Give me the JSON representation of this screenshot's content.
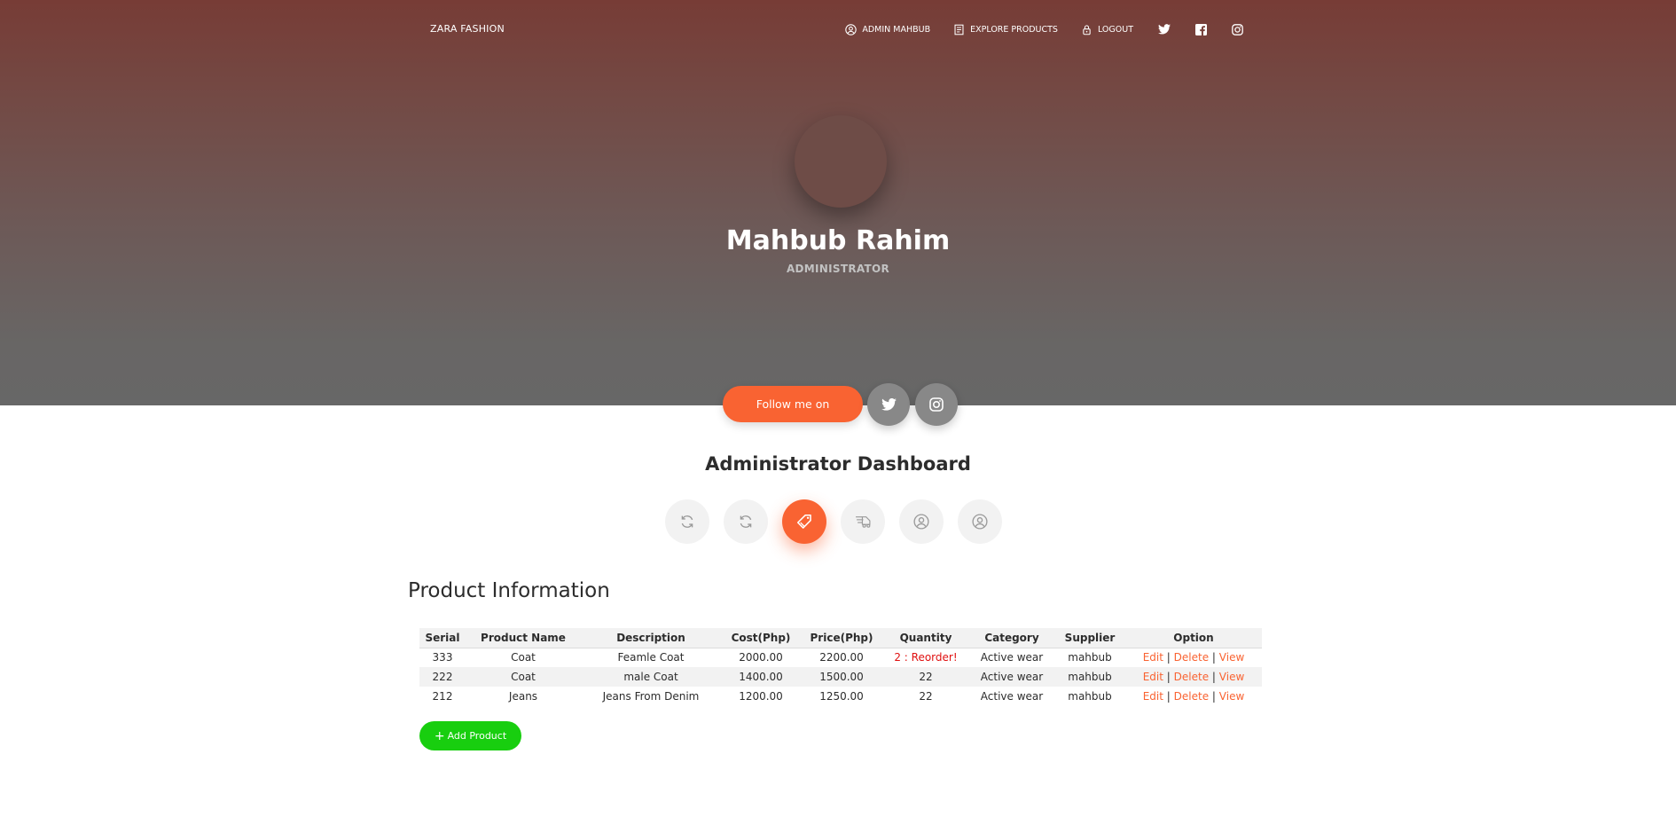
{
  "nav": {
    "brand": "ZARA FASHION",
    "links": [
      {
        "label": "ADMIN MAHBUB",
        "icon": "user-circle-icon"
      },
      {
        "label": "EXPLORE PRODUCTS",
        "icon": "document-icon"
      },
      {
        "label": "LOGOUT",
        "icon": "lock-icon"
      }
    ],
    "social": [
      "twitter-icon",
      "facebook-icon",
      "instagram-icon"
    ]
  },
  "profile": {
    "name": "Mahbub Rahim",
    "role": "ADMINISTRATOR"
  },
  "follow": {
    "label": "Follow me on",
    "social": [
      "twitter-icon",
      "instagram-icon"
    ]
  },
  "dashboard": {
    "title": "Administrator Dashboard",
    "tabs": [
      {
        "icon": "refresh-icon",
        "active": false
      },
      {
        "icon": "refresh-icon",
        "active": false
      },
      {
        "icon": "tag-icon",
        "active": true
      },
      {
        "icon": "delivery-icon",
        "active": false
      },
      {
        "icon": "user-circle-icon",
        "active": false
      },
      {
        "icon": "user-circle-icon",
        "active": false
      }
    ]
  },
  "products": {
    "title": "Product Information",
    "headers": [
      "Serial",
      "Product Name",
      "Description",
      "Cost(Php)",
      "Price(Php)",
      "Quantity",
      "Category",
      "Supplier",
      "Option"
    ],
    "rows": [
      {
        "serial": "333",
        "name": "Coat",
        "description": "Feamle Coat",
        "cost": "2000.00",
        "price": "2200.00",
        "quantity": "2 : Reorder!",
        "reorder": true,
        "category": "Active wear",
        "supplier": "mahbub"
      },
      {
        "serial": "222",
        "name": "Coat",
        "description": "male Coat",
        "cost": "1400.00",
        "price": "1500.00",
        "quantity": "22",
        "reorder": false,
        "category": "Active wear",
        "supplier": "mahbub"
      },
      {
        "serial": "212",
        "name": "Jeans",
        "description": "Jeans From Denim",
        "cost": "1200.00",
        "price": "1250.00",
        "quantity": "22",
        "reorder": false,
        "category": "Active wear",
        "supplier": "mahbub"
      }
    ],
    "options": {
      "edit": "Edit",
      "delete": "Delete",
      "view": "View",
      "separator": "|"
    },
    "add_label": "Add Product"
  },
  "colors": {
    "accent": "#f96332",
    "success": "#18ce0f",
    "reorder": "#e01010"
  }
}
